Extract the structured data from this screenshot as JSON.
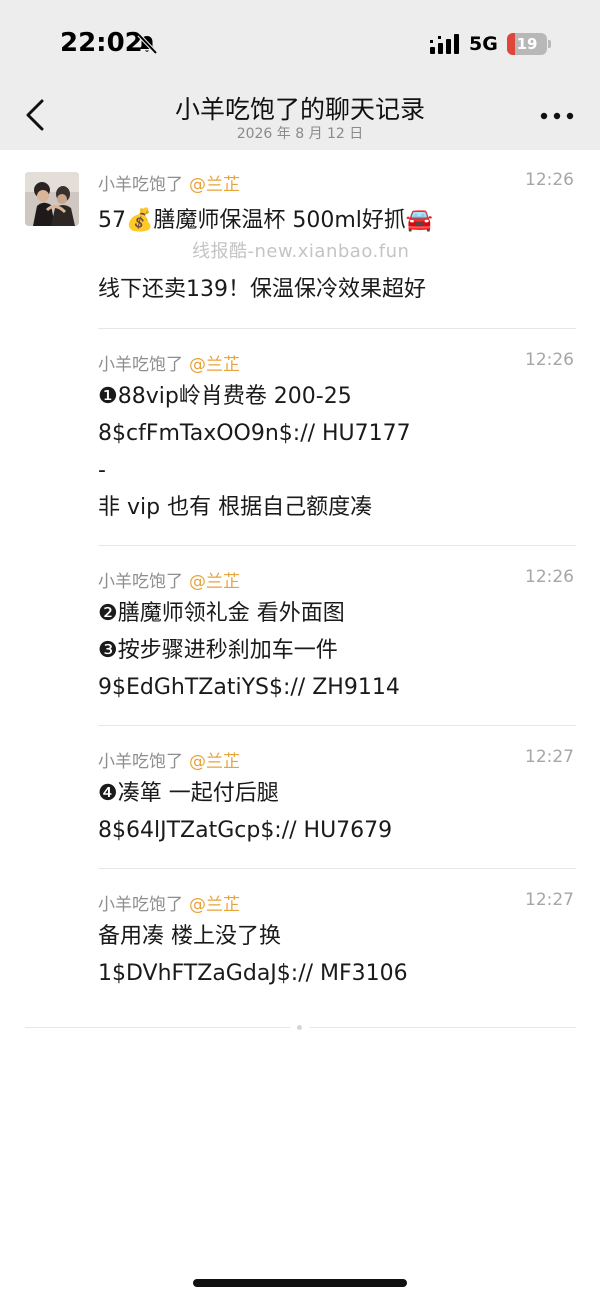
{
  "status_bar": {
    "time": "22:02",
    "network": "5G",
    "battery_level": "19",
    "battery_fraction": 0.19,
    "mute_icon": "bell-slash-icon",
    "signal_icon": "signal-bars-icon"
  },
  "nav": {
    "title": "小羊吃饱了的聊天记录",
    "subtitle": "2026 年 8 月 12 日",
    "back_icon": "chevron-left-icon",
    "more_icon": "ellipsis-icon"
  },
  "colors": {
    "header_bg": "#ededed",
    "mention": "#e8a33a",
    "sender": "#8e8e8e",
    "battery_low": "#e0453a"
  },
  "messages": [
    {
      "sender": "小羊吃饱了",
      "mention": "@兰芷",
      "time": "12:26",
      "lines": [
        "57💰膳魔师保温杯 500ml好抓🚘",
        "线下还卖139！保温保冷效果超好"
      ],
      "watermark": "线报酷-new.xianbao.fun"
    },
    {
      "sender": "小羊吃饱了",
      "mention": "@兰芷",
      "time": "12:26",
      "lines": [
        "❶88vip岭肖费卷 200-25",
        "8$cfFmTaxOO9n$:// HU7177",
        "-",
        "非 vip 也有 根据自己额度凑"
      ]
    },
    {
      "sender": "小羊吃饱了",
      "mention": "@兰芷",
      "time": "12:26",
      "lines": [
        "❷膳魔师领礼金 看外面图",
        "❸按步骤进秒刹加车一件",
        "9$EdGhTZatiYS$:// ZH9114"
      ]
    },
    {
      "sender": "小羊吃饱了",
      "mention": "@兰芷",
      "time": "12:27",
      "lines": [
        "❹凑箪 一起付后腿",
        "8$64lJTZatGcp$:// HU7679"
      ]
    },
    {
      "sender": "小羊吃饱了",
      "mention": "@兰芷",
      "time": "12:27",
      "lines": [
        "备用凑 楼上没了换",
        "1$DVhFTZaGdaJ$:// MF3106"
      ]
    }
  ]
}
